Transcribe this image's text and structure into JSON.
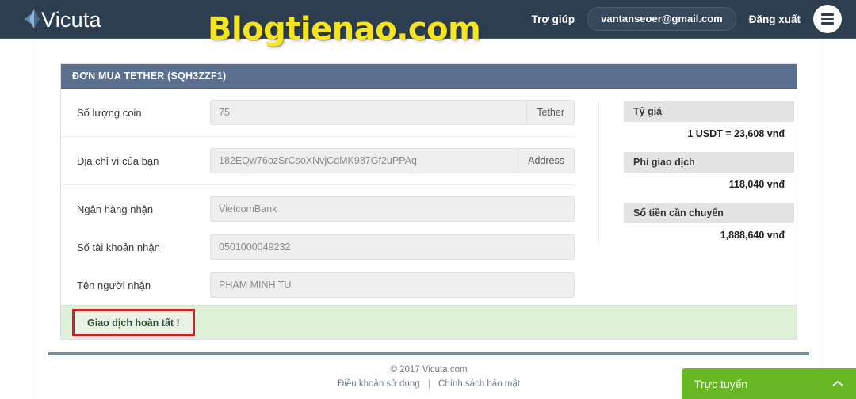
{
  "brand": {
    "name": "Vicuta",
    "mark_icon": "diamond-arrow-logo-icon"
  },
  "header": {
    "help_label": "Trợ giúp",
    "user_email": "vantanseoer@gmail.com",
    "logout_label": "Đăng xuất",
    "menu_icon": "hamburger-menu-icon",
    "background_color": "#2d3e50"
  },
  "watermark": {
    "text": "Blogtienao.com",
    "color": "#f5e520"
  },
  "panel": {
    "title": "ĐƠN MUA TETHER (SQH3ZZF1)",
    "header_color": "#5b6f8e"
  },
  "form": {
    "fields": [
      {
        "label": "Số lượng coin",
        "value": "75",
        "addon": "Tether"
      },
      {
        "label": "Địa chỉ ví của bạn",
        "value": "182EQw76ozSrCsoXNvjCdMK987Gf2uPPAq",
        "addon": "Address"
      },
      {
        "label": "Ngân hàng nhận",
        "value": "VietcomBank",
        "addon": ""
      },
      {
        "label": "Số tài khoản nhận",
        "value": "0501000049232",
        "addon": ""
      },
      {
        "label": "Tên người nhận",
        "value": "PHAM MINH TU",
        "addon": ""
      }
    ]
  },
  "summary": {
    "blocks": [
      {
        "title": "Tỷ giá",
        "value": "1 USDT = 23,608 vnđ"
      },
      {
        "title": "Phí giao dịch",
        "value": "118,040 vnđ"
      },
      {
        "title": "Số tiền cần chuyển",
        "value": "1,888,640 vnđ"
      }
    ]
  },
  "alert": {
    "action_label": "Giao dịch hoàn tất !",
    "background_color": "#dff0d8",
    "highlight_border_color": "#cc2027"
  },
  "footer": {
    "copyright": "© 2017 Vicuta.com",
    "terms_label": "Điều khoản sử dụng",
    "separator": "|",
    "privacy_label": "Chính sách bảo mật"
  },
  "chat": {
    "label": "Trực tuyến",
    "chevron_icon": "chevron-up-icon",
    "background_color": "#68b724"
  }
}
